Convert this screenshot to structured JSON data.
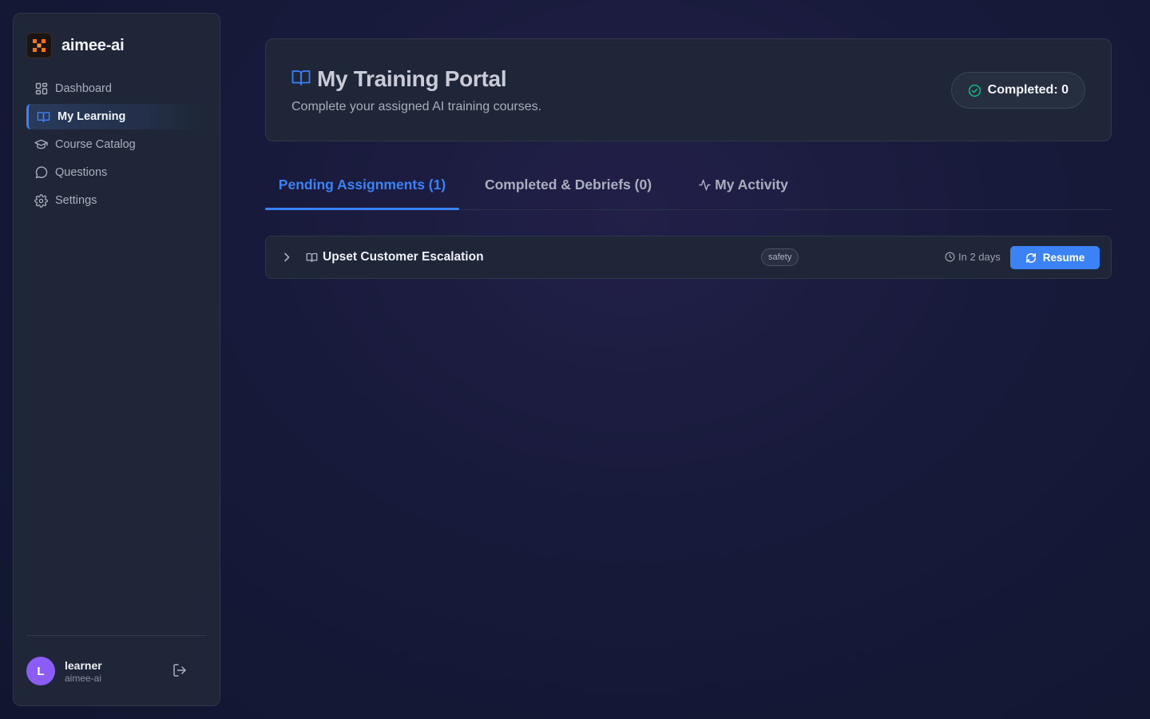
{
  "app": {
    "brand_name": "aimee-ai",
    "logo_icon": "checker-logo-icon"
  },
  "sidebar": {
    "items": [
      {
        "label": "Dashboard",
        "icon": "grid-icon",
        "active": false
      },
      {
        "label": "My Learning",
        "icon": "book-open-icon",
        "active": true
      },
      {
        "label": "Course Catalog",
        "icon": "graduation-cap-icon",
        "active": false
      },
      {
        "label": "Questions",
        "icon": "message-circle-icon",
        "active": false
      },
      {
        "label": "Settings",
        "icon": "gear-icon",
        "active": false
      }
    ],
    "user": {
      "initial": "L",
      "name": "learner",
      "org": "aimee-ai",
      "avatar_color": "#8b5cf6"
    },
    "logout_icon": "logout-icon"
  },
  "header": {
    "title": "My Training Portal",
    "subtitle": "Complete your assigned AI training courses.",
    "completed_label": "Completed: 0"
  },
  "tabs": [
    {
      "label": "Pending Assignments (1)",
      "active": true
    },
    {
      "label": "Completed & Debriefs (0)",
      "active": false
    },
    {
      "label": "My Activity",
      "active": false,
      "icon": "activity-icon"
    }
  ],
  "assignments": [
    {
      "title": "Upset Customer Escalation",
      "tag": "safety",
      "due": "In 2 days",
      "action_label": "Resume"
    }
  ],
  "colors": {
    "accent": "#3b82f6",
    "success": "#10b981",
    "sidebar_bg": "#1e2637",
    "logo_orange": "#f97316"
  }
}
